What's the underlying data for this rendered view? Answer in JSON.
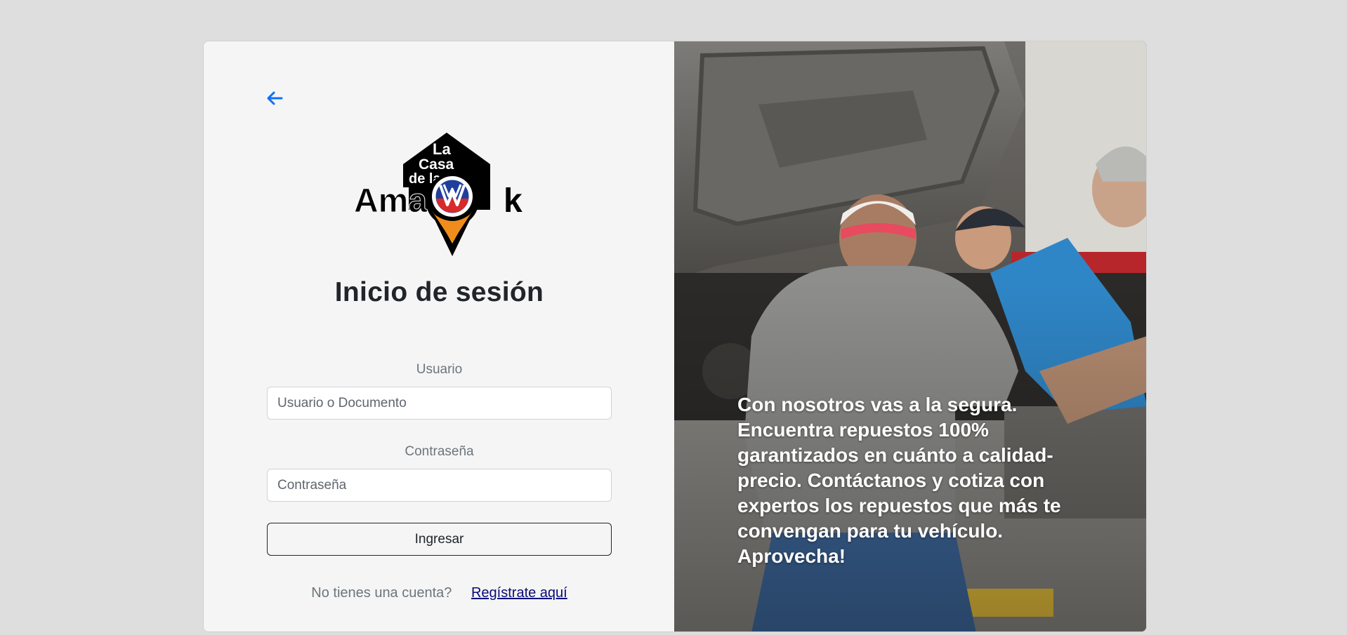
{
  "login": {
    "title": "Inicio de sesión",
    "username_label": "Usuario",
    "username_placeholder": "Usuario o Documento",
    "password_label": "Contraseña",
    "password_placeholder": "Contraseña",
    "submit_label": "Ingresar",
    "no_account_text": "No tienes una cuenta?",
    "register_link": "Regístrate aquí"
  },
  "logo": {
    "line1": "La",
    "line2": "Casa",
    "line3": "de la",
    "word_left": "Amar",
    "word_right": "k"
  },
  "promo": {
    "text": "Con nosotros vas a la segura. Encuentra repuestos 100% garantizados en cuánto a calidad-precio. Contáctanos y cotiza con expertos los repuestos que más te convengan para tu vehículo. Aprovecha!"
  },
  "icons": {
    "back": "arrow-left-icon",
    "logo_badge": "vw-map-pin-icon"
  },
  "colors": {
    "accent_blue": "#0d6efd",
    "link": "#0a0a78",
    "text_dark": "#212529",
    "text_muted": "#6c757d"
  }
}
